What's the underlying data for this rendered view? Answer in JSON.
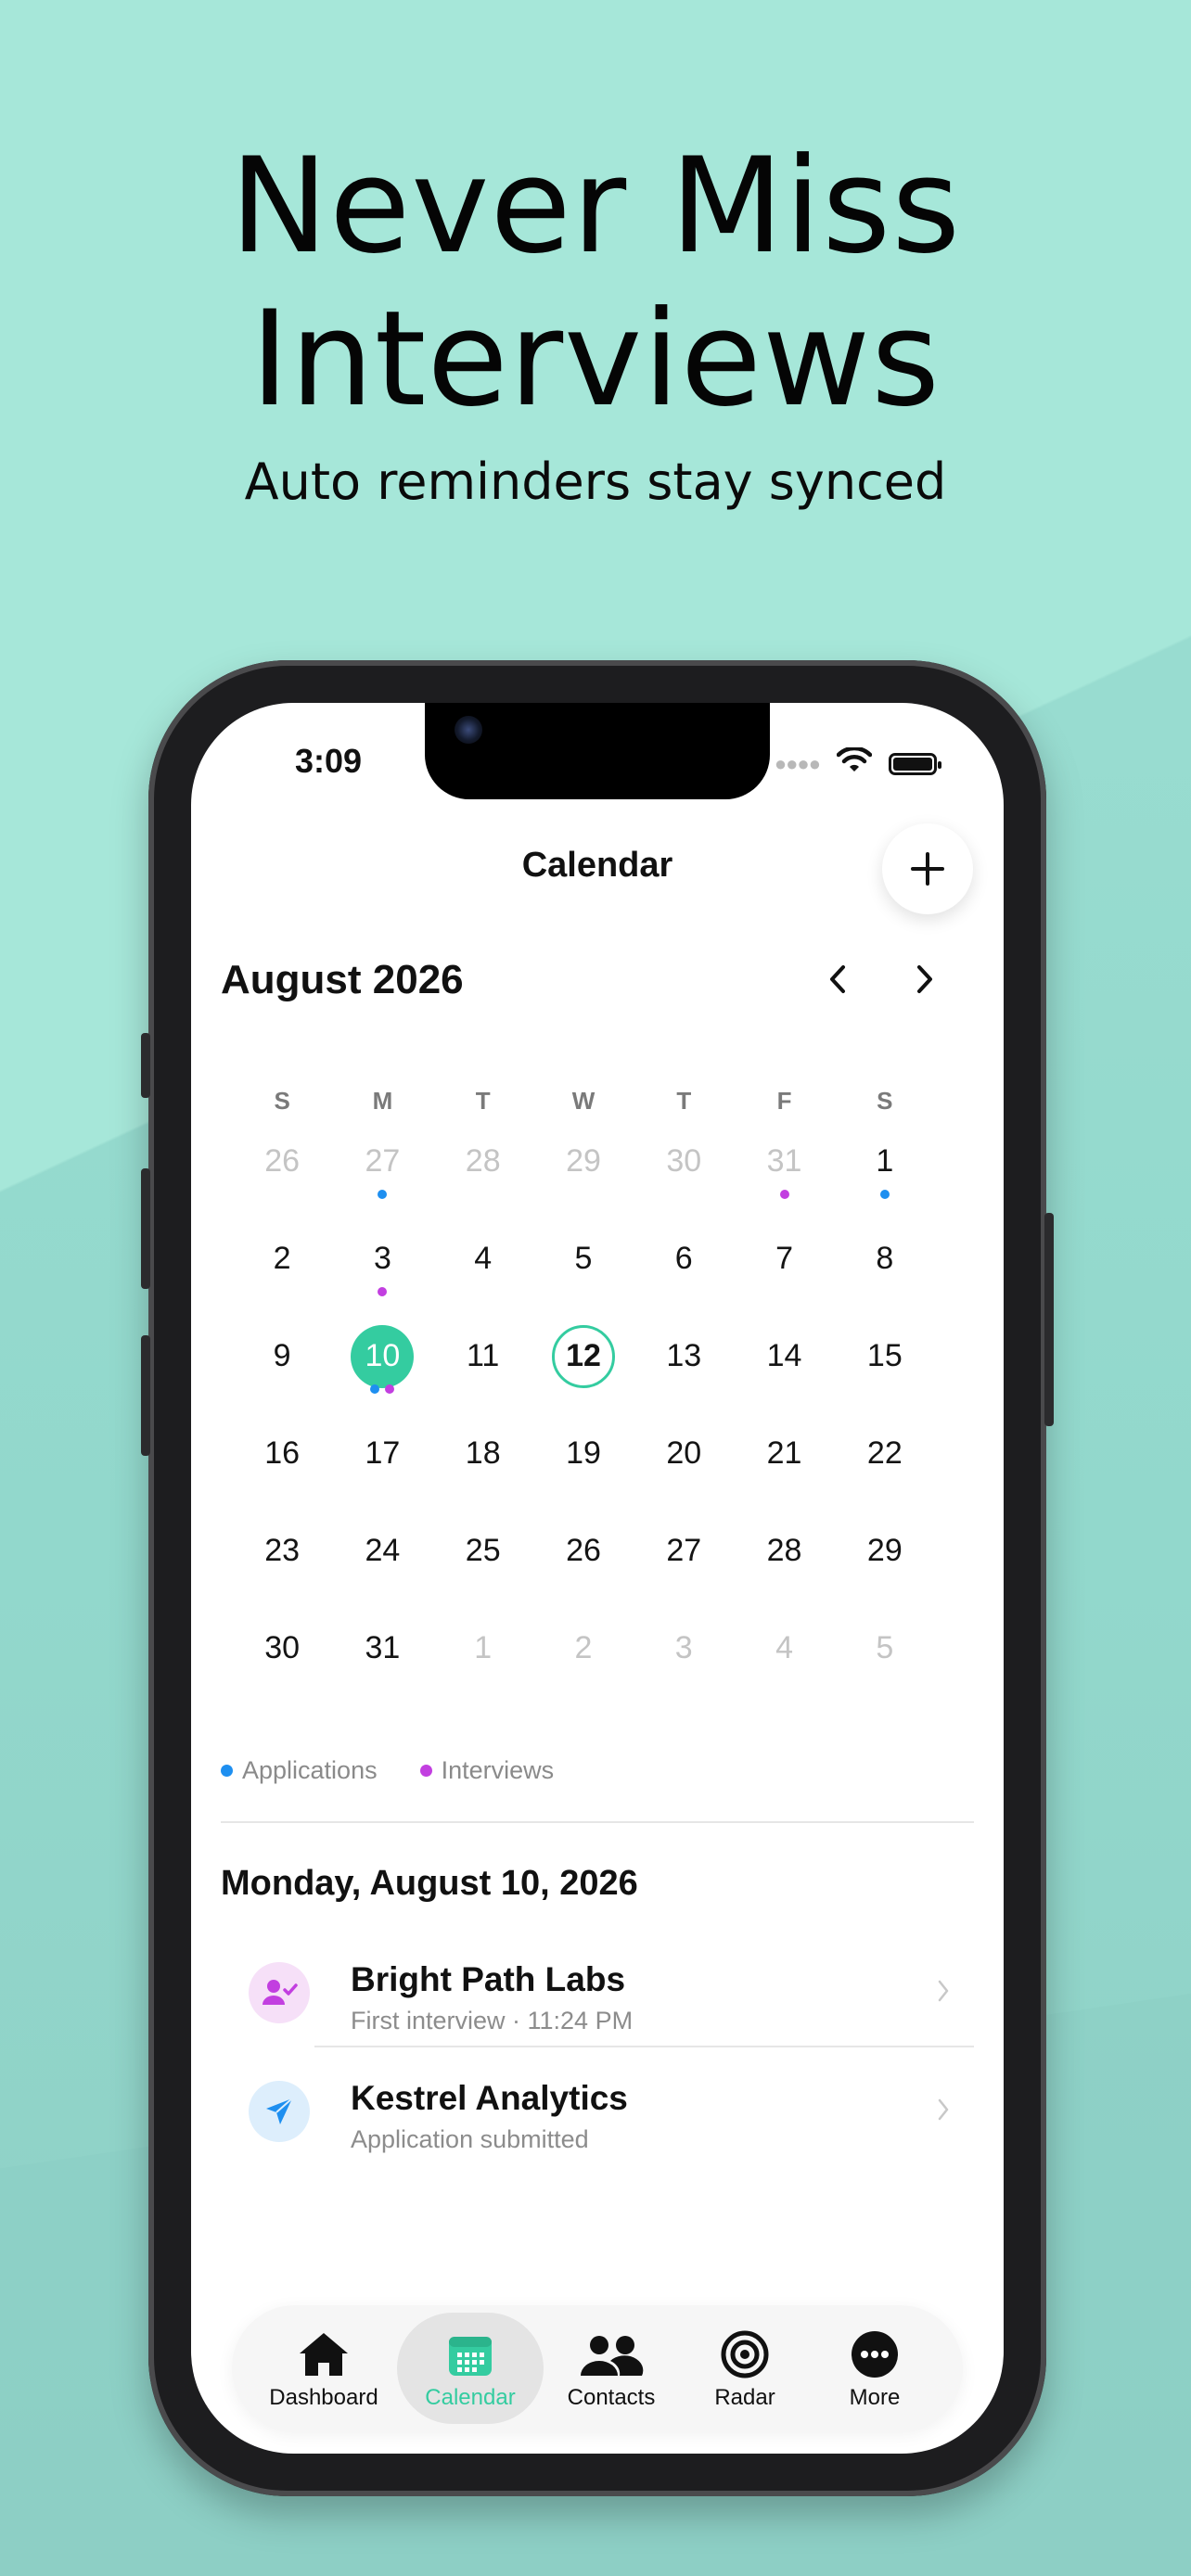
{
  "headline": {
    "line1": "Never Miss",
    "line2": "Interviews"
  },
  "subline": "Auto reminders stay synced",
  "status_bar": {
    "time": "3:09"
  },
  "nav": {
    "title": "Calendar",
    "add_label": "+"
  },
  "calendar": {
    "month_label": "August 2026",
    "weekdays": [
      "S",
      "M",
      "T",
      "W",
      "T",
      "F",
      "S"
    ],
    "weeks": [
      [
        {
          "d": "26",
          "muted": true
        },
        {
          "d": "27",
          "muted": true,
          "dots": [
            "blue"
          ]
        },
        {
          "d": "28",
          "muted": true
        },
        {
          "d": "29",
          "muted": true
        },
        {
          "d": "30",
          "muted": true
        },
        {
          "d": "31",
          "muted": true,
          "dots": [
            "purple"
          ]
        },
        {
          "d": "1",
          "dots": [
            "blue"
          ]
        }
      ],
      [
        {
          "d": "2"
        },
        {
          "d": "3",
          "dots": [
            "purple"
          ]
        },
        {
          "d": "4"
        },
        {
          "d": "5"
        },
        {
          "d": "6"
        },
        {
          "d": "7"
        },
        {
          "d": "8"
        }
      ],
      [
        {
          "d": "9"
        },
        {
          "d": "10",
          "selected": true,
          "dots": [
            "blue",
            "purple"
          ]
        },
        {
          "d": "11"
        },
        {
          "d": "12",
          "today": true
        },
        {
          "d": "13"
        },
        {
          "d": "14"
        },
        {
          "d": "15"
        }
      ],
      [
        {
          "d": "16"
        },
        {
          "d": "17"
        },
        {
          "d": "18"
        },
        {
          "d": "19"
        },
        {
          "d": "20"
        },
        {
          "d": "21"
        },
        {
          "d": "22"
        }
      ],
      [
        {
          "d": "23"
        },
        {
          "d": "24"
        },
        {
          "d": "25"
        },
        {
          "d": "26"
        },
        {
          "d": "27"
        },
        {
          "d": "28"
        },
        {
          "d": "29"
        }
      ],
      [
        {
          "d": "30"
        },
        {
          "d": "31"
        },
        {
          "d": "1",
          "muted": true
        },
        {
          "d": "2",
          "muted": true
        },
        {
          "d": "3",
          "muted": true
        },
        {
          "d": "4",
          "muted": true
        },
        {
          "d": "5",
          "muted": true
        }
      ]
    ]
  },
  "legend": {
    "applications": "Applications",
    "interviews": "Interviews"
  },
  "colors": {
    "accent": "#34cca0",
    "applications": "#1e8ff0",
    "interviews": "#c23fe0"
  },
  "selected_day": {
    "heading": "Monday, August 10, 2026",
    "events": [
      {
        "title": "Bright Path Labs",
        "subtitle": "First interview · 11:24 PM",
        "icon": "interview-person-check-icon"
      },
      {
        "title": "Kestrel Analytics",
        "subtitle": "Application submitted",
        "icon": "paper-plane-icon"
      }
    ]
  },
  "tabs": [
    {
      "label": "Dashboard",
      "icon": "house-icon"
    },
    {
      "label": "Calendar",
      "icon": "calendar-icon",
      "active": true
    },
    {
      "label": "Contacts",
      "icon": "people-icon"
    },
    {
      "label": "Radar",
      "icon": "target-icon"
    },
    {
      "label": "More",
      "icon": "ellipsis-circle-icon"
    }
  ]
}
